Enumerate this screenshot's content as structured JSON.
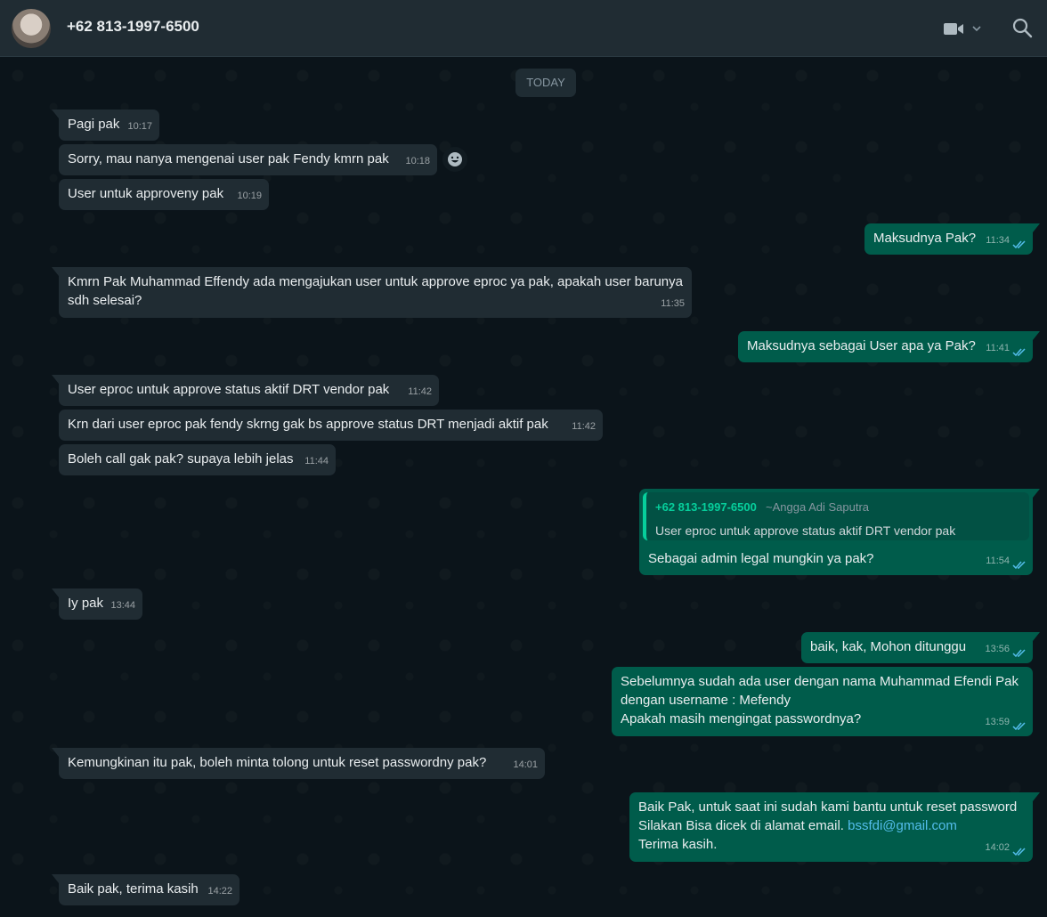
{
  "header": {
    "contact_name": "+62 813-1997-6500",
    "icons": [
      "avatar",
      "video-call-icon",
      "chevron-down-icon",
      "search-icon"
    ]
  },
  "chat": {
    "date_divider": "TODAY",
    "messages": [
      {
        "dir": "in",
        "text": "Pagi pak",
        "time": "10:17"
      },
      {
        "dir": "in",
        "text": "Sorry, mau nanya mengenai user pak Fendy kmrn pak",
        "time": "10:18"
      },
      {
        "dir": "in",
        "text": "User untuk approveny pak",
        "time": "10:19"
      },
      {
        "dir": "out",
        "text": "Maksudnya Pak?",
        "time": "11:34"
      },
      {
        "dir": "in",
        "text": "Kmrn Pak Muhammad Effendy ada mengajukan user untuk approve eproc ya pak, apakah user barunya sdh selesai?",
        "time": "11:35"
      },
      {
        "dir": "out",
        "text": "Maksudnya sebagai User apa ya Pak?",
        "time": "11:41"
      },
      {
        "dir": "in",
        "text": "User eproc untuk approve status aktif DRT vendor pak",
        "time": "11:42"
      },
      {
        "dir": "in",
        "text": "Krn dari user eproc pak fendy skrng gak bs approve status DRT menjadi aktif pak",
        "time": "11:42"
      },
      {
        "dir": "in",
        "text": "Boleh call gak pak? supaya lebih jelas",
        "time": "11:44"
      },
      {
        "dir": "out",
        "text": "Sebagai admin legal mungkin ya pak?",
        "time": "11:54",
        "quote": {
          "author": "+62 813-1997-6500",
          "alias": "~Angga Adi Saputra",
          "text": "User eproc untuk approve status aktif DRT vendor pak"
        }
      },
      {
        "dir": "in",
        "text": "Iy pak",
        "time": "13:44"
      },
      {
        "dir": "out",
        "text": "baik, kak, Mohon ditunggu",
        "time": "13:56"
      },
      {
        "dir": "out",
        "text": "Sebelumnya sudah ada user dengan nama Muhammad Efendi Pak\ndengan username : Mefendy\nApakah masih mengingat passwordnya?",
        "time": "13:59"
      },
      {
        "dir": "in",
        "text": "Kemungkinan itu pak, boleh minta tolong untuk reset passwordny pak?",
        "time": "14:01"
      },
      {
        "dir": "out",
        "text_before": "Baik Pak, untuk saat ini sudah kami bantu untuk reset password\nSilakan Bisa dicek di alamat email. ",
        "link": "bssfdi@gmail.com",
        "text_after": "\nTerima kasih.",
        "time": "14:02"
      },
      {
        "dir": "in",
        "text": "Baik pak, terima kasih",
        "time": "14:22"
      }
    ]
  },
  "colors": {
    "background": "#0b141a",
    "header": "#202c33",
    "incoming_bubble": "#202c33",
    "outgoing_bubble": "#005c4b",
    "read_ticks": "#53bdeb",
    "quote_accent": "#06cf9c"
  }
}
